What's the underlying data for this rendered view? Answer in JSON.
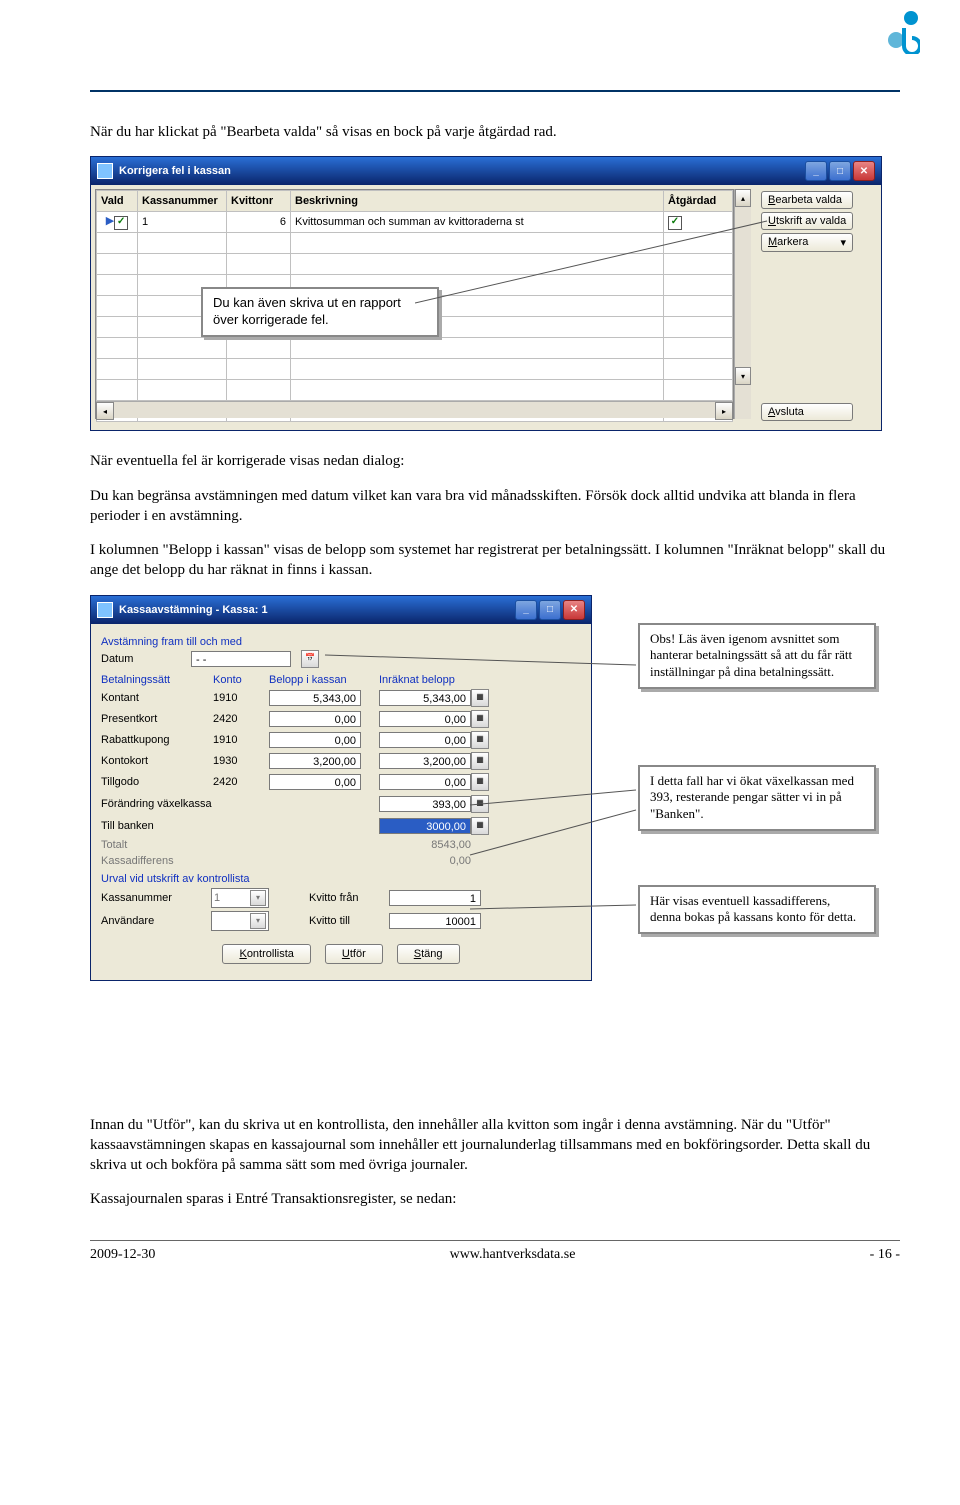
{
  "body": {
    "p1": "När du har klickat på \"Bearbeta valda\" så visas en bock på varje åtgärdad rad.",
    "p2": "När eventuella fel är korrigerade visas nedan dialog:",
    "p3": "Du kan begränsa avstämningen med datum vilket kan vara bra vid månadsskiften. Försök dock alltid undvika att blanda in flera perioder i en avstämning.",
    "p4": "I kolumnen \"Belopp i kassan\" visas de belopp som systemet har registrerat per betalningssätt. I kolumnen \"Inräknat belopp\" skall du ange det belopp du har räknat in finns i kassan.",
    "p5": "Innan du \"Utför\", kan du skriva ut en kontrollista, den innehåller alla kvitton som ingår i denna avstämning. När du \"Utför\" kassaavstämningen skapas en kassajournal som innehåller ett journalunderlag tillsammans med en bokföringsorder. Detta skall du skriva ut och bokföra på samma sätt som med övriga journaler.",
    "p6": "Kassajournalen sparas i Entré Transaktionsregister, se nedan:"
  },
  "callouts": {
    "c1": "Du kan även skriva ut en rapport över korrigerade fel.",
    "c2": "Obs! Läs även igenom avsnittet som hanterar betalningssätt så att du får rätt inställningar på dina betalningssätt.",
    "c3": "I detta fall har vi ökat växelkassan med 393, resterande pengar sätter vi in på \"Banken\".",
    "c4": "Här visas eventuell kassadifferens, denna bokas på kassans konto för detta."
  },
  "win1": {
    "title": "Korrigera fel i kassan",
    "cols": {
      "vald": "Vald",
      "kassanummer": "Kassanummer",
      "kvittonr": "Kvittonr",
      "beskrivning": "Beskrivning",
      "atgardad": "Åtgärdad"
    },
    "row": {
      "kassanummer": "1",
      "kvittonr": "6",
      "beskrivning": "Kvittosumman och summan av kvittoraderna st"
    },
    "btns": {
      "bearbeta": "Bearbeta valda",
      "utskrift": "Utskrift av valda",
      "markera": "Markera",
      "avsluta": "Avsluta"
    }
  },
  "win2": {
    "title": "Kassaavstämning - Kassa: 1",
    "headers": {
      "avst": "Avstämning fram till och med",
      "datum": "Datum",
      "datumval": "- -"
    },
    "cols": {
      "betalningssatt": "Betalningssätt",
      "konto": "Konto",
      "belopp": "Belopp i kassan",
      "inraknat": "Inräknat belopp"
    },
    "rows": [
      {
        "n": "Kontant",
        "k": "1910",
        "b": "5,343,00",
        "i": "5,343,00"
      },
      {
        "n": "Presentkort",
        "k": "2420",
        "b": "0,00",
        "i": "0,00"
      },
      {
        "n": "Rabattkupong",
        "k": "1910",
        "b": "0,00",
        "i": "0,00"
      },
      {
        "n": "Kontokort",
        "k": "1930",
        "b": "3,200,00",
        "i": "3,200,00"
      },
      {
        "n": "Tillgodo",
        "k": "2420",
        "b": "0,00",
        "i": "0,00"
      }
    ],
    "extra": {
      "forandring_l": "Förändring växelkassa",
      "forandring_v": "393,00",
      "tillbanken_l": "Till banken",
      "tillbanken_v": "3000,00",
      "totalt_l": "Totalt",
      "totalt_v": "8543,00",
      "diff_l": "Kassadifferens",
      "diff_v": "0,00"
    },
    "urval": {
      "hdr": "Urval vid utskrift av kontrollista",
      "kassanr_l": "Kassanummer",
      "kassanr_v": "1",
      "anv_l": "Användare",
      "kvfran_l": "Kvitto från",
      "kvfran_v": "1",
      "kvtill_l": "Kvitto till",
      "kvtill_v": "10001"
    },
    "btns": {
      "kontrollista": "Kontrollista",
      "utfor": "Utför",
      "stang": "Stäng"
    }
  },
  "footer": {
    "date": "2009-12-30",
    "url": "www.hantverksdata.se",
    "page": "- 16 -"
  }
}
